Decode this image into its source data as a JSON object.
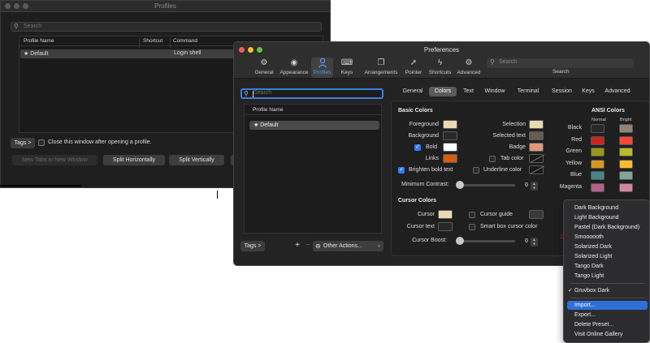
{
  "profiles_window": {
    "title": "Profiles",
    "search_placeholder": "Search",
    "columns": [
      "Profile Name",
      "Shortcut",
      "Command"
    ],
    "rows": [
      {
        "name": "★ Default",
        "shortcut": "",
        "command": "Login shell"
      }
    ],
    "tags_label": "Tags >",
    "close_after_open_label": "Close this window after opening a profile.",
    "close_after_open_checked": false,
    "buttons": {
      "new_tabs": "New Tabs in New Window",
      "split_horizontally": "Split Horizontally",
      "split_vertically": "Split Vertically"
    }
  },
  "prefs": {
    "title": "Preferences",
    "toolbar": [
      {
        "label": "General",
        "icon": "gear-icon",
        "glyph": "⚙"
      },
      {
        "label": "Appearance",
        "icon": "eye-icon",
        "glyph": "◉"
      },
      {
        "label": "Profiles",
        "icon": "person-icon",
        "glyph": "👤"
      },
      {
        "label": "Keys",
        "icon": "keyboard-icon",
        "glyph": "⌨"
      },
      {
        "label": "Arrangements",
        "icon": "windows-icon",
        "glyph": "❐"
      },
      {
        "label": "Pointer",
        "icon": "pointer-icon",
        "glyph": "➚"
      },
      {
        "label": "Shortcuts",
        "icon": "bolt-icon",
        "glyph": "ϟ"
      },
      {
        "label": "Advanced",
        "icon": "gears-icon",
        "glyph": "⚙"
      }
    ],
    "search_placeholder": "Search",
    "search_label": "Search",
    "profile_search_placeholder": "Search",
    "profile_list_header": "Profile Name",
    "profiles": [
      "★ Default"
    ],
    "tags_label": "Tags >",
    "add_label": "+",
    "remove_label": "−",
    "other_actions_label": "Other Actions...",
    "tabs": [
      "General",
      "Colors",
      "Text",
      "Window",
      "Terminal",
      "Session",
      "Keys",
      "Advanced"
    ],
    "active_tab": "Colors"
  },
  "colors": {
    "basic_title": "Basic Colors",
    "foreground": {
      "label": "Foreground",
      "color": "#ebdbb2"
    },
    "background": {
      "label": "Background",
      "color": "#282828"
    },
    "bold": {
      "label": "Bold",
      "checked": true,
      "color": "#ffffff"
    },
    "links": {
      "label": "Links",
      "color": "#d65d0e"
    },
    "selection": {
      "label": "Selection",
      "color": "#ebdbb2"
    },
    "selected_text": {
      "label": "Selected text",
      "color": "#665c54"
    },
    "badge": {
      "label": "Badge",
      "color": "#e0977a"
    },
    "tab_color": {
      "label": "Tab color",
      "checked": false
    },
    "brighten_bold": {
      "label": "Brighten bold text",
      "checked": true
    },
    "underline_color": {
      "label": "Underline color",
      "checked": false
    },
    "min_contrast": {
      "label": "Minimum Contrast:",
      "value": "0",
      "fraction": 0.0
    },
    "cursor_title": "Cursor Colors",
    "cursor": {
      "label": "Cursor",
      "color": "#ebdbb2"
    },
    "cursor_guide": {
      "label": "Cursor guide",
      "checked": false,
      "color": "#3c3836"
    },
    "cursor_text": {
      "label": "Cursor text",
      "color": "#282828"
    },
    "smart_box": {
      "label": "Smart box cursor color",
      "checked": false
    },
    "cursor_boost": {
      "label": "Cursor Boost:",
      "value": "0",
      "fraction": 0.0
    },
    "ansi_title": "ANSI Colors",
    "ansi_normal": "Normal",
    "ansi_bright": "Bright",
    "ansi": [
      {
        "name": "Black",
        "normal": "#282828",
        "bright": "#928374"
      },
      {
        "name": "Red",
        "normal": "#cc241d",
        "bright": "#fb4934"
      },
      {
        "name": "Green",
        "normal": "#98971a",
        "bright": "#b8bb26"
      },
      {
        "name": "Yellow",
        "normal": "#d79921",
        "bright": "#fabd2f"
      },
      {
        "name": "Blue",
        "normal": "#458588",
        "bright": "#83a598"
      },
      {
        "name": "Magenta",
        "normal": "#b16286",
        "bright": "#d3869b"
      }
    ]
  },
  "presets_menu": {
    "group1": [
      "Dark Background",
      "Light Background",
      "Pastel (Dark Background)",
      "Smoooooth",
      "Solarized Dark",
      "Solarized Light",
      "Tango Dark",
      "Tango Light"
    ],
    "group2": [
      "Gruvbox Dark"
    ],
    "checked": "Gruvbox Dark",
    "group3": [
      "Import...",
      "Export...",
      "Delete Preset...",
      "Visit Online Gallery"
    ],
    "highlighted": "Import..."
  },
  "annotation_marker": "1"
}
